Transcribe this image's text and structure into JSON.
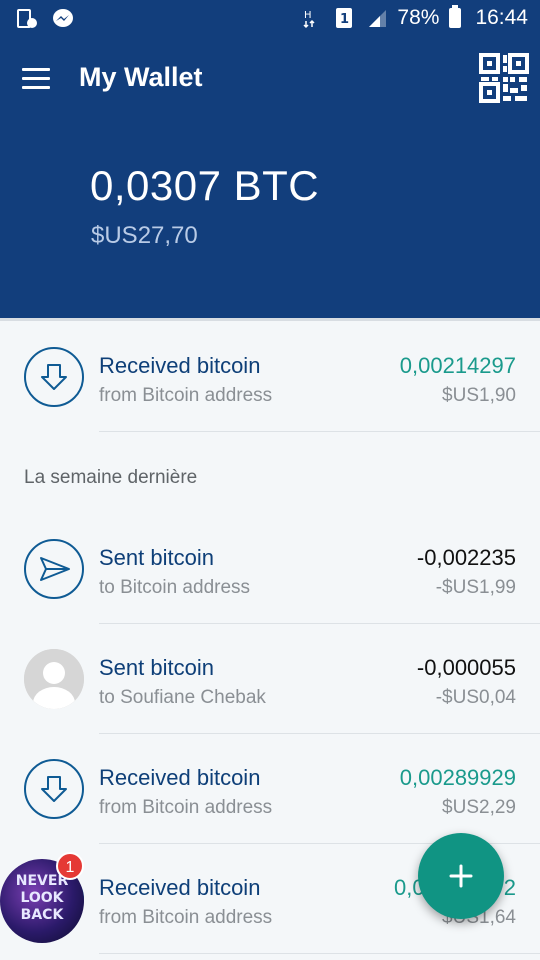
{
  "status_bar": {
    "battery": "78%",
    "time": "16:44",
    "icons": [
      "sim-download-icon",
      "messenger-icon",
      "network-h-icon",
      "sim-1-icon",
      "signal-icon",
      "battery-icon"
    ]
  },
  "header": {
    "title": "My Wallet",
    "balance_btc": "0,0307 BTC",
    "balance_fiat": "$US27,70",
    "icons": [
      "hamburger-icon",
      "qr-code-icon"
    ]
  },
  "transactions": [
    {
      "type": "received",
      "title": "Received bitcoin",
      "subtitle": "from Bitcoin address",
      "amount": "0,00214297",
      "fiat": "$US1,90"
    },
    {
      "type": "sent",
      "title": "Sent bitcoin",
      "subtitle": "to Bitcoin address",
      "amount": "-0,002235",
      "fiat": "-$US1,99"
    },
    {
      "type": "sent-contact",
      "title": "Sent bitcoin",
      "subtitle": "to Soufiane Chebak",
      "amount": "-0,000055",
      "fiat": "-$US0,04"
    },
    {
      "type": "received",
      "title": "Received bitcoin",
      "subtitle": "from Bitcoin address",
      "amount": "0,00289929",
      "fiat": "$US2,29"
    },
    {
      "type": "received",
      "title": "Received bitcoin",
      "subtitle": "from Bitcoin address",
      "amount": "0,00",
      "amount_tail": "2",
      "fiat": "$US1,64"
    }
  ],
  "section_label": "La semaine dernière",
  "chathead": {
    "badge": "1",
    "text": "NEVER LOOK BACK"
  },
  "colors": {
    "primary": "#123e7c",
    "accent": "#109483",
    "received": "#1a9a8c"
  }
}
